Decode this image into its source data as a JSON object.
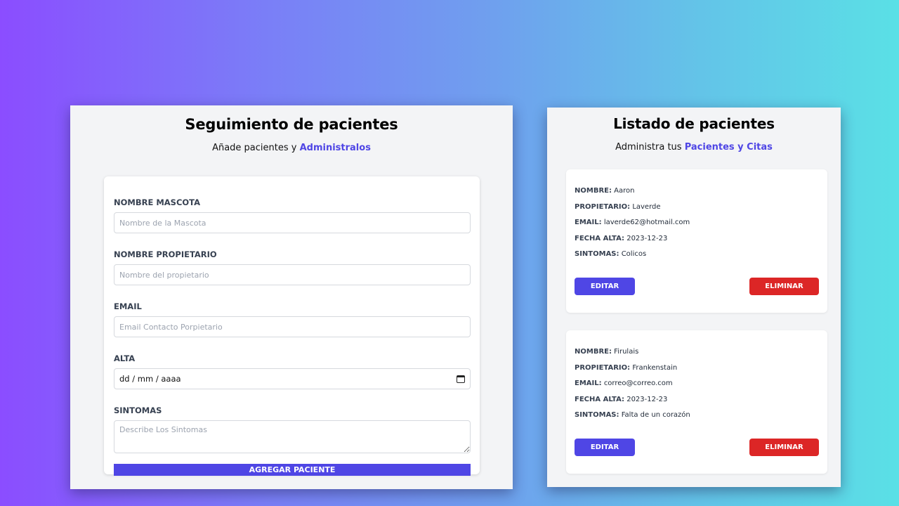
{
  "form_panel": {
    "title": "Seguimiento de pacientes",
    "subtitle_prefix": "Añade pacientes y ",
    "subtitle_accent": "Administralos",
    "fields": {
      "mascota": {
        "label": "NOMBRE MASCOTA",
        "placeholder": "Nombre de la Mascota",
        "value": ""
      },
      "propietario": {
        "label": "NOMBRE PROPIETARIO",
        "placeholder": "Nombre del propietario",
        "value": ""
      },
      "email": {
        "label": "EMAIL",
        "placeholder": "Email Contacto Porpietario",
        "value": ""
      },
      "alta": {
        "label": "ALTA",
        "value": "dd / mm / aaaa"
      },
      "sintomas": {
        "label": "SINTOMAS",
        "placeholder": "Describe Los Sintomas",
        "value": ""
      }
    },
    "submit_label": "AGREGAR PACIENTE"
  },
  "list_panel": {
    "title": "Listado de pacientes",
    "subtitle_prefix": "Administra tus ",
    "subtitle_accent": "Pacientes y Citas",
    "keys": {
      "nombre": "NOMBRE:",
      "propietario": "PROPIETARIO:",
      "email": "EMAIL:",
      "fecha": "FECHA ALTA:",
      "sintomas": "SINTOMAS:"
    },
    "patients": [
      {
        "nombre": "Aaron",
        "propietario": "Laverde",
        "email": "laverde62@hotmail.com",
        "fecha": "2023-12-23",
        "sintomas": "Colicos",
        "edit_label": "EDITAR",
        "delete_label": "ELIMINAR"
      },
      {
        "nombre": "Firulais",
        "propietario": "Frankenstain",
        "email": "correo@correo.com",
        "fecha": "2023-12-23",
        "sintomas": "Falta de un corazón",
        "edit_label": "EDITAR",
        "delete_label": "ELIMINAR"
      }
    ]
  },
  "colors": {
    "accent": "#4f46e5",
    "danger": "#dc2626",
    "panel_bg": "#f3f4f6"
  },
  "icons": {
    "date_picker": "calendar-icon"
  }
}
